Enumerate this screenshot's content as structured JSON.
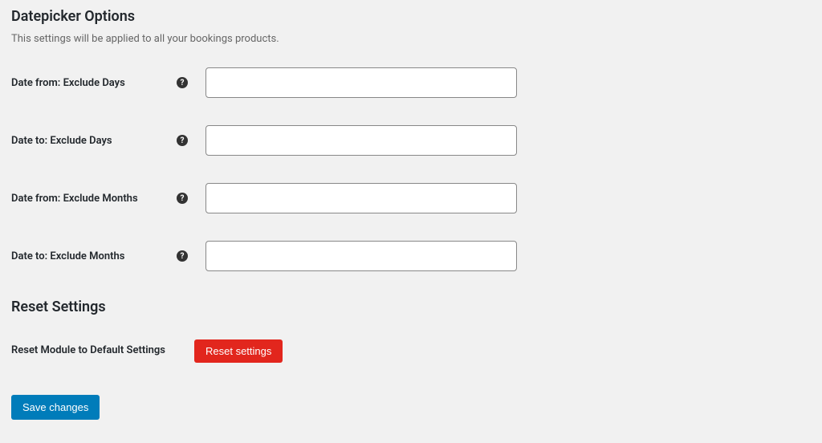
{
  "header": {
    "title": "Datepicker Options",
    "description": "This settings will be applied to all your bookings products."
  },
  "fields": {
    "date_from_exclude_days": {
      "label": "Date from: Exclude Days",
      "value": ""
    },
    "date_to_exclude_days": {
      "label": "Date to: Exclude Days",
      "value": ""
    },
    "date_from_exclude_months": {
      "label": "Date from: Exclude Months",
      "value": ""
    },
    "date_to_exclude_months": {
      "label": "Date to: Exclude Months",
      "value": ""
    }
  },
  "reset": {
    "section_title": "Reset Settings",
    "label": "Reset Module to Default Settings",
    "button": "Reset settings"
  },
  "save": {
    "button": "Save changes"
  }
}
